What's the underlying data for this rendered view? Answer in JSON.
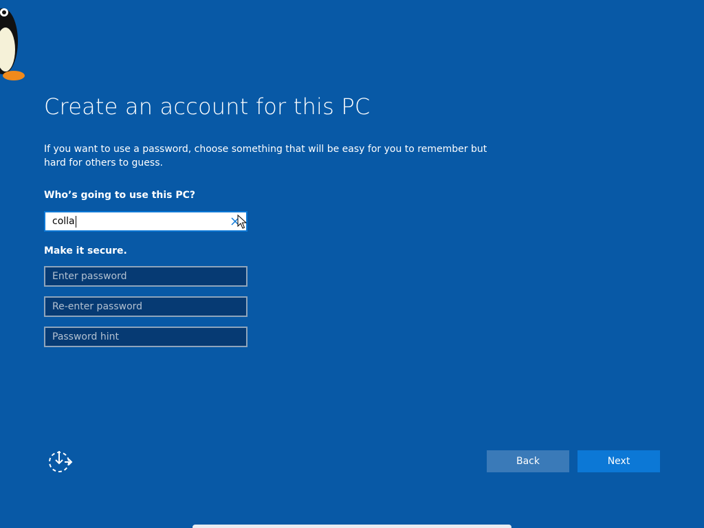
{
  "page": {
    "title": "Create an account for this PC",
    "description": "If you want to use a password, choose something that will be easy for you to remember but hard for others to guess."
  },
  "form": {
    "who_label": "Who’s going to use this PC?",
    "username_value": "colla",
    "secure_label": "Make it secure.",
    "password_placeholder": "Enter password",
    "reenter_placeholder": "Re-enter password",
    "hint_placeholder": "Password hint"
  },
  "buttons": {
    "back_label": "Back",
    "next_label": "Next"
  },
  "icons": {
    "mascot": "penguin-icon",
    "clear": "clear-x-icon",
    "accessibility": "ease-of-access-icon",
    "cursor": "mouse-pointer-icon"
  },
  "colors": {
    "background": "#0859a6",
    "accent": "#0c78d6",
    "back_button": "#3a7ab8"
  }
}
